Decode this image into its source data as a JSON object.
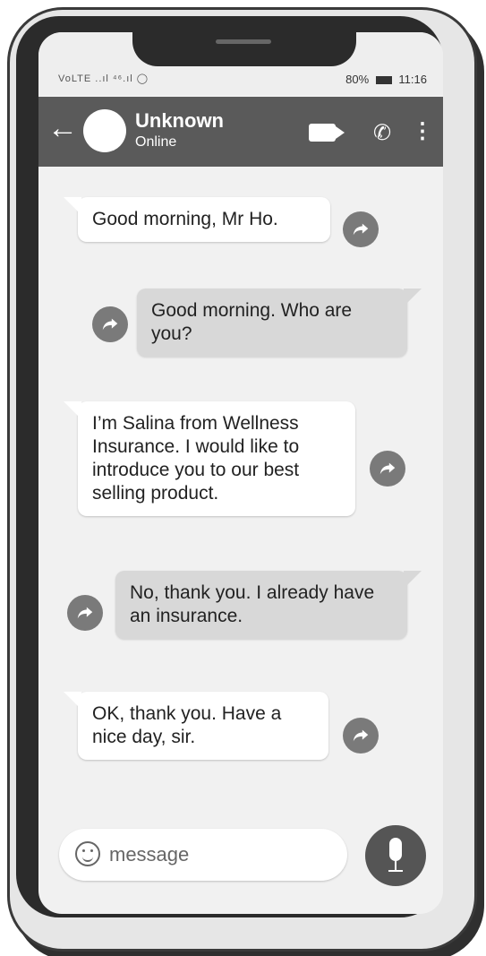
{
  "status_bar": {
    "left": "VoLTE ..ıl ⁴⁶.ıl ◯",
    "right": "80%",
    "time": "11:16"
  },
  "chat_header": {
    "contact_name": "Unknown",
    "status": "Online"
  },
  "messages": [
    {
      "direction": "incoming",
      "text": "Good morning, Mr Ho."
    },
    {
      "direction": "outgoing",
      "text": "Good morning. Who are you?"
    },
    {
      "direction": "incoming",
      "text": "I’m Salina from Wellness Insurance. I would like to introduce you to our best selling product."
    },
    {
      "direction": "outgoing",
      "text": "No, thank you. I already have an insurance."
    },
    {
      "direction": "incoming",
      "text": "OK, thank you. Have a nice day, sir."
    }
  ],
  "composer": {
    "placeholder": "message"
  },
  "colors": {
    "appbar": "#5a5a5a",
    "incoming_bubble": "#ffffff",
    "outgoing_bubble": "#d8d8d8",
    "screen_background": "#f1f1f1"
  },
  "icons": {
    "back": "arrow-left-icon",
    "video": "video-camera-icon",
    "call": "phone-icon",
    "more": "more-vert-icon",
    "share": "share-arrow-icon",
    "emoji": "emoji-icon",
    "mic": "microphone-icon"
  }
}
